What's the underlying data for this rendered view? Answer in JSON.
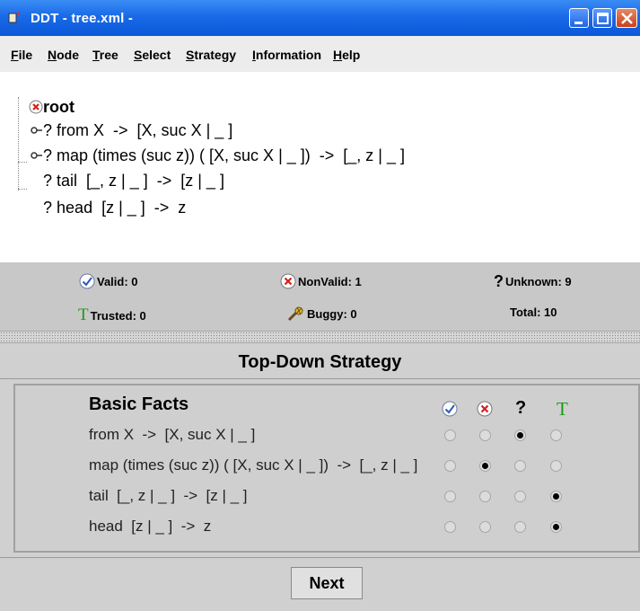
{
  "window": {
    "title": "DDT  - tree.xml -"
  },
  "menu": [
    "File",
    "Node",
    "Tree",
    "Select",
    "Strategy",
    "Information",
    "Help"
  ],
  "tree": {
    "root": "root",
    "nodes": [
      {
        "prefix": "? ",
        "text": "from X  ->  [X, suc X | _ ]",
        "expandable": true
      },
      {
        "prefix": "? ",
        "text": "map (times (suc z)) ( [X, suc X | _ ])  ->  [_, z | _ ]",
        "expandable": true
      },
      {
        "prefix": "? ",
        "text": "tail  [_, z | _ ]  ->  [z | _ ]",
        "expandable": false
      },
      {
        "prefix": "? ",
        "text": "head  [z | _ ]  ->  z",
        "expandable": false
      }
    ]
  },
  "stats": {
    "valid": "Valid: 0",
    "nonvalid": "NonValid: 1",
    "unknown": "Unknown: 9",
    "trusted": "Trusted: 0",
    "buggy": "Buggy: 0",
    "total": "Total: 10"
  },
  "strategy": {
    "title": "Top-Down Strategy",
    "heading": "Basic Facts",
    "columns": [
      "valid-icon",
      "nonvalid-icon",
      "unknown-icon",
      "trusted-icon"
    ],
    "facts": [
      {
        "label": "from X  ->  [X, suc X | _ ]",
        "selected": 2
      },
      {
        "label": "map (times (suc z)) ( [X, suc X | _ ])  ->  [_, z | _ ]",
        "selected": 1
      },
      {
        "label": "tail  [_, z | _ ]  ->  [z | _ ]",
        "selected": 3
      },
      {
        "label": "head  [z | _ ]  ->  z",
        "selected": 3
      }
    ],
    "next_label": "Next"
  },
  "colors": {
    "titlebar": "#1a6ae8",
    "nonvalid_red": "#d42020",
    "trusted_green": "#1a9a1a",
    "valid_blue": "#2a5ab8"
  }
}
